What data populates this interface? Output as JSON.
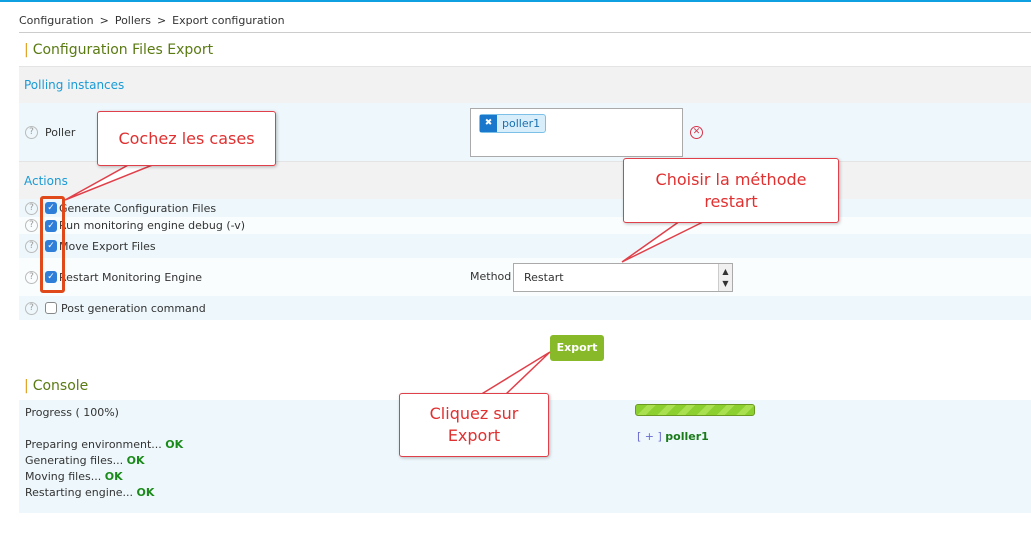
{
  "breadcrumb": [
    "Configuration",
    ">",
    "Pollers",
    ">",
    "Export configuration"
  ],
  "title": "Configuration Files Export",
  "polling": {
    "header": "Polling instances",
    "label": "Poller",
    "selected": "poller1"
  },
  "actions": {
    "header": "Actions",
    "items": [
      {
        "label": "Generate Configuration Files",
        "checked": true
      },
      {
        "label": "Run monitoring engine debug (-v)",
        "checked": true
      },
      {
        "label": "Move Export Files",
        "checked": true
      },
      {
        "label": "Restart Monitoring Engine",
        "checked": true
      },
      {
        "label": "Post generation command",
        "checked": false
      }
    ],
    "method_label": "Method",
    "method_value": "Restart"
  },
  "export_label": "Export",
  "console": {
    "title": "Console",
    "progress_label": "Progress ( 100%)",
    "progress": 100,
    "log": [
      {
        "t": "Preparing environment... ",
        "s": "OK"
      },
      {
        "t": "Generating files... ",
        "s": "OK"
      },
      {
        "t": "Moving files... ",
        "s": "OK"
      },
      {
        "t": "Restarting engine... ",
        "s": "OK"
      }
    ],
    "poller_toggle": "[ + ]",
    "poller": "poller1"
  },
  "callouts": {
    "c1": "Cochez les cases",
    "c2": "Choisir la méthode restart",
    "c3": "Cliquez sur Export"
  },
  "colors": {
    "accent": "#1a9ad6",
    "title": "#5a7a12",
    "export": "#88b928",
    "ok": "#1a8a1a",
    "callout": "#e0404a"
  }
}
